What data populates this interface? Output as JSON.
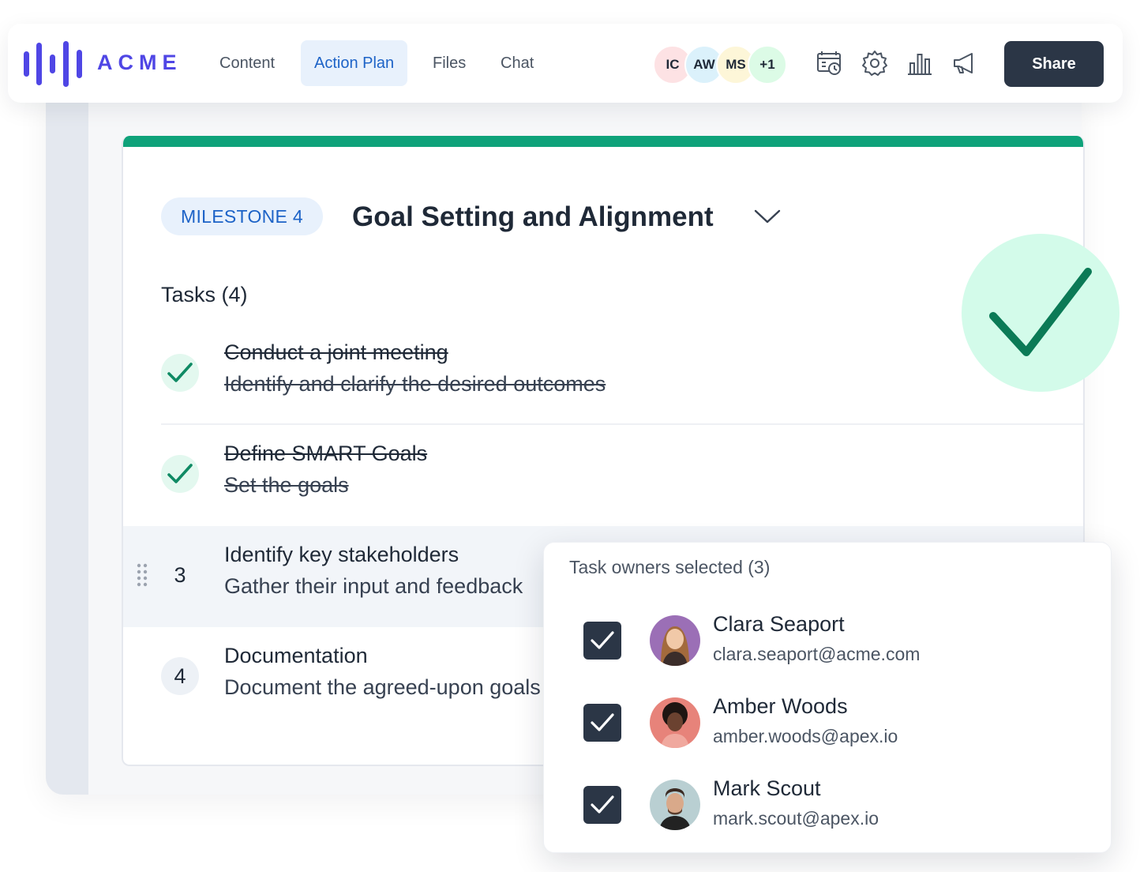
{
  "brand": {
    "name": "ACME",
    "color": "#4f46e5"
  },
  "nav": {
    "items": [
      {
        "label": "Content",
        "active": false
      },
      {
        "label": "Action Plan",
        "active": true
      },
      {
        "label": "Files",
        "active": false
      },
      {
        "label": "Chat",
        "active": false
      }
    ]
  },
  "collaborators": [
    {
      "initials": "IC",
      "color": "#fde2e4"
    },
    {
      "initials": "AW",
      "color": "#dbf1fb"
    },
    {
      "initials": "MS",
      "color": "#fdf6d8"
    },
    {
      "initials": "+1",
      "color": "#dcfbe6"
    }
  ],
  "toolbar": {
    "icons": [
      "calendar-clock-icon",
      "gear-icon",
      "bar-chart-icon",
      "megaphone-icon"
    ],
    "share_label": "Share"
  },
  "milestone": {
    "badge": "MILESTONE 4",
    "title": "Goal Setting and Alignment",
    "accent_color": "#0fa27a",
    "tasks_heading": "Tasks (4)",
    "tasks": [
      {
        "title": "Conduct a joint meeting",
        "subtitle": "Identify and clarify the desired outcomes",
        "done": true,
        "number": "1"
      },
      {
        "title": "Define SMART Goals",
        "subtitle": "Set the goals",
        "done": true,
        "number": "2"
      },
      {
        "title": "Identify key stakeholders",
        "subtitle": "Gather their input and feedback",
        "done": false,
        "number": "3"
      },
      {
        "title": "Documentation",
        "subtitle": "Document the agreed-upon goals",
        "done": false,
        "number": "4"
      }
    ]
  },
  "owners": {
    "heading": "Task owners selected (3)",
    "list": [
      {
        "name": "Clara Seaport",
        "email": "clara.seaport@acme.com",
        "checked": true
      },
      {
        "name": "Amber Woods",
        "email": "amber.woods@apex.io",
        "checked": true
      },
      {
        "name": "Mark Scout",
        "email": "mark.scout@apex.io",
        "checked": true
      }
    ]
  }
}
